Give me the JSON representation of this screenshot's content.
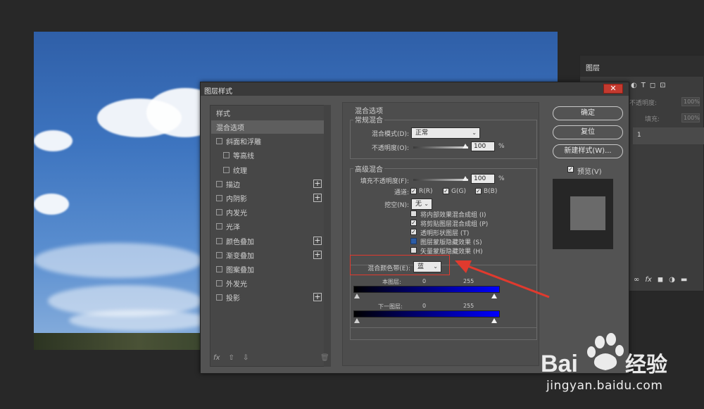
{
  "layers_panel": {
    "tab": "图层",
    "opacity_label": "不透明度:",
    "opacity_value": "100%",
    "fill_label": "填充:",
    "fill_value": "100%",
    "layer_number": "1",
    "top_icons": [
      "T",
      "◻",
      "⊡",
      "◐"
    ],
    "bottom_icons": [
      "∞",
      "fx",
      "◼",
      "◑",
      "▬"
    ]
  },
  "dialog": {
    "title": "图层样式",
    "close_symbol": "✕",
    "style_list": {
      "header": "样式",
      "items": [
        {
          "label": "混合选项",
          "checkbox": false,
          "plus": false,
          "selected": true,
          "indent": 0
        },
        {
          "label": "斜面和浮雕",
          "checkbox": true,
          "plus": false,
          "indent": 0
        },
        {
          "label": "等高线",
          "checkbox": true,
          "plus": false,
          "indent": 1
        },
        {
          "label": "纹理",
          "checkbox": true,
          "plus": false,
          "indent": 1
        },
        {
          "label": "描边",
          "checkbox": true,
          "plus": true,
          "indent": 0
        },
        {
          "label": "内阴影",
          "checkbox": true,
          "plus": true,
          "indent": 0
        },
        {
          "label": "内发光",
          "checkbox": true,
          "plus": false,
          "indent": 0
        },
        {
          "label": "光泽",
          "checkbox": true,
          "plus": false,
          "indent": 0
        },
        {
          "label": "颜色叠加",
          "checkbox": true,
          "plus": true,
          "indent": 0
        },
        {
          "label": "渐变叠加",
          "checkbox": true,
          "plus": true,
          "indent": 0
        },
        {
          "label": "图案叠加",
          "checkbox": true,
          "plus": false,
          "indent": 0
        },
        {
          "label": "外发光",
          "checkbox": true,
          "plus": false,
          "indent": 0
        },
        {
          "label": "投影",
          "checkbox": true,
          "plus": true,
          "indent": 0
        }
      ],
      "footer": {
        "fx": "fx",
        "up": "⇧",
        "down": "⇩",
        "trash": "🗑"
      }
    },
    "blend_options": {
      "title": "混合选项",
      "general": {
        "title": "常规混合",
        "mode_label": "混合模式(D):",
        "mode_value": "正常",
        "opacity_label": "不透明度(O):",
        "opacity_value": "100",
        "pct": "%"
      },
      "advanced": {
        "title": "高级混合",
        "fill_label": "填充不透明度(F):",
        "fill_value": "100",
        "pct": "%",
        "channels_label": "通道:",
        "channels": [
          "R(R)",
          "G(G)",
          "B(B)"
        ],
        "knockout_label": "挖空(N):",
        "knockout_value": "无",
        "options": [
          {
            "label": "将内部效果混合成组 (I)",
            "checked": false
          },
          {
            "label": "将剪贴图层混合成组 (P)",
            "checked": true
          },
          {
            "label": "透明形状图层 (T)",
            "checked": true
          },
          {
            "label": "图层蒙版隐藏效果 (S)",
            "checked": false
          },
          {
            "label": "矢量蒙版隐藏效果 (H)",
            "checked": false
          }
        ]
      },
      "blend_if": {
        "label": "混合颜色带(E):",
        "value": "蓝",
        "this_layer": "本图层:",
        "underlying": "下一图层:",
        "min": "0",
        "max": "255"
      }
    },
    "buttons": {
      "ok": "确定",
      "reset": "复位",
      "new_style": "新建样式(W)...",
      "preview_label": "预览(V)"
    }
  },
  "watermark": {
    "brand": "Baidu经验",
    "url": "jingyan.baidu.com"
  },
  "colors": {
    "annotation_red": "#e03a2e",
    "gradient_end_blue": "#0000ff"
  }
}
